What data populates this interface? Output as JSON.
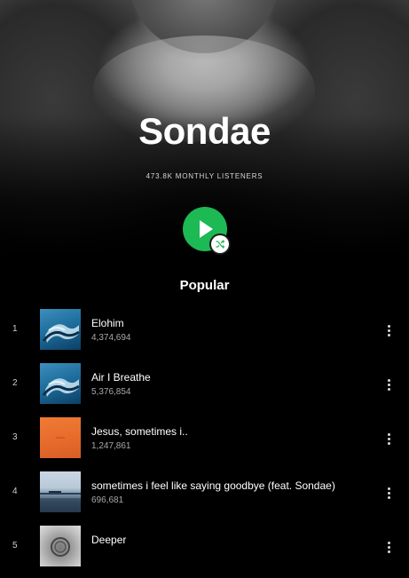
{
  "artist": {
    "name": "Sondae",
    "monthly_listeners": "473.8K MONTHLY LISTENERS"
  },
  "section": {
    "title": "Popular"
  },
  "tracks": [
    {
      "index": "1",
      "title": "Elohim",
      "plays": "4,374,694",
      "art": "blue-wave"
    },
    {
      "index": "2",
      "title": "Air I Breathe",
      "plays": "5,376,854",
      "art": "blue-wave"
    },
    {
      "index": "3",
      "title": "Jesus, sometimes i..",
      "plays": "1,247,861",
      "art": "orange"
    },
    {
      "index": "4",
      "title": "sometimes i feel like saying goodbye (feat. Sondae)",
      "plays": "696,681",
      "art": "seascape"
    },
    {
      "index": "5",
      "title": "Deeper",
      "plays": "",
      "art": "gray"
    }
  ],
  "icons": {
    "play": "play-icon",
    "shuffle": "shuffle-icon",
    "more": "more-vertical-icon"
  },
  "colors": {
    "accent": "#1db954",
    "background": "#000000",
    "text_primary": "#ffffff",
    "text_secondary": "#a8a8a8"
  }
}
